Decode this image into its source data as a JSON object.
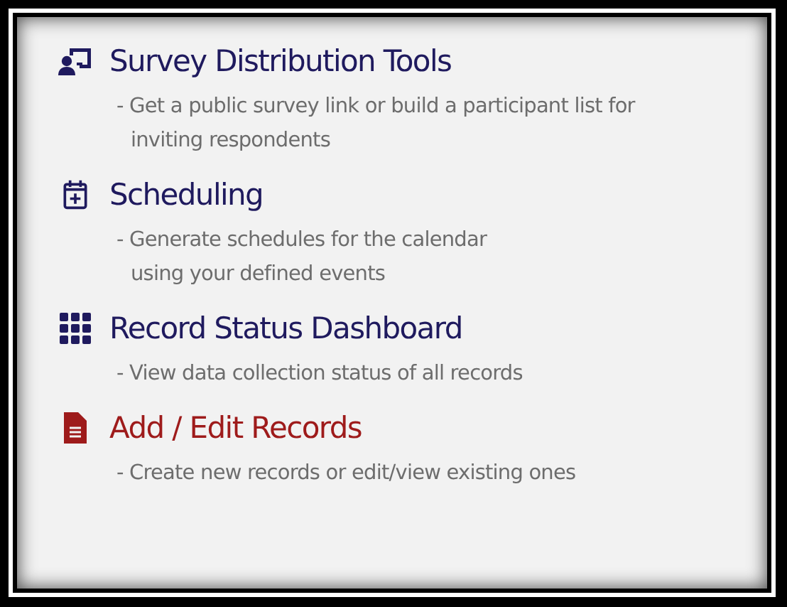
{
  "items": [
    {
      "kind": "survey",
      "title": "Survey Distribution Tools",
      "color": "#1f1a5e",
      "description": [
        "- Get a public survey link or build a participant list for",
        "inviting respondents"
      ]
    },
    {
      "kind": "calendar",
      "title": "Scheduling",
      "color": "#1f1a5e",
      "description": [
        "- Generate schedules for the calendar",
        "using your defined events"
      ]
    },
    {
      "kind": "grid",
      "title": "Record Status Dashboard",
      "color": "#1f1a5e",
      "description": [
        "- View data collection status of all records"
      ]
    },
    {
      "kind": "file",
      "title": "Add / Edit Records",
      "color": "#9e1b1b",
      "description": [
        "- Create new records or edit/view existing ones"
      ]
    }
  ]
}
